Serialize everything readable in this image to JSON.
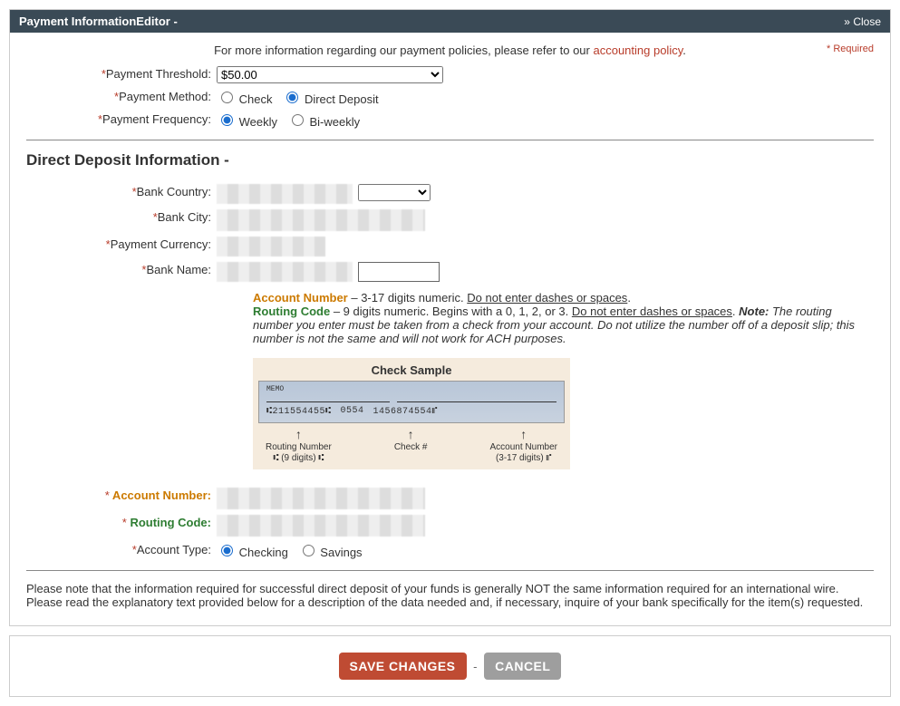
{
  "header": {
    "title": "Payment InformationEditor -",
    "close": "Close"
  },
  "intro": {
    "text_before": "For more information regarding our payment policies, please refer to our ",
    "link": "accounting policy",
    "text_after": ".",
    "required_note": "* Required"
  },
  "fields": {
    "threshold": {
      "label": "Payment Threshold:",
      "value": "$50.00"
    },
    "method": {
      "label": "Payment Method:",
      "opt1": "Check",
      "opt2": "Direct Deposit",
      "selected": "Direct Deposit"
    },
    "frequency": {
      "label": "Payment Frequency:",
      "opt1": "Weekly",
      "opt2": "Bi-weekly",
      "selected": "Weekly"
    }
  },
  "section_title": "Direct Deposit Information -",
  "dd": {
    "bank_country": "Bank Country:",
    "bank_city": "Bank City:",
    "payment_currency": "Payment Currency:",
    "bank_name": "Bank Name:"
  },
  "hints": {
    "acct_label": "Account Number",
    "acct_rest": " – 3-17 digits numeric. ",
    "acct_under": "Do not enter dashes or spaces",
    "acct_end": ".",
    "rout_label": "Routing Code",
    "rout_rest": " – 9 digits numeric. Begins with a 0, 1, 2, or 3. ",
    "rout_under": "Do not enter dashes or spaces",
    "rout_end": ". ",
    "note_label": "Note:",
    "note_rest": " The routing number you enter must be taken from a check from your account. Do not utilize the number off of a deposit slip; this number is not the same and will not work for ACH purposes."
  },
  "check_sample": {
    "title": "Check Sample",
    "memo": "MEMO",
    "routing": "⑆211554455⑆",
    "checkno": "0554",
    "account": "1456874554⑈",
    "l1": "Routing Number",
    "l1b": "(9 digits)",
    "l2": "Check #",
    "l3": "Account Number",
    "l3b": "(3-17 digits)"
  },
  "dd2": {
    "account_number": " Account Number:",
    "routing_code": " Routing Code:",
    "account_type": "Account Type:",
    "opt1": "Checking",
    "opt2": "Savings",
    "selected": "Checking"
  },
  "footer_note": "Please note that the information required for successful direct deposit of your funds is generally NOT the same information required for an international wire. Please read the explanatory text provided below for a description of the data needed and, if necessary, inquire of your bank specifically for the item(s) requested.",
  "buttons": {
    "save": "SAVE CHANGES",
    "cancel": "CANCEL"
  }
}
